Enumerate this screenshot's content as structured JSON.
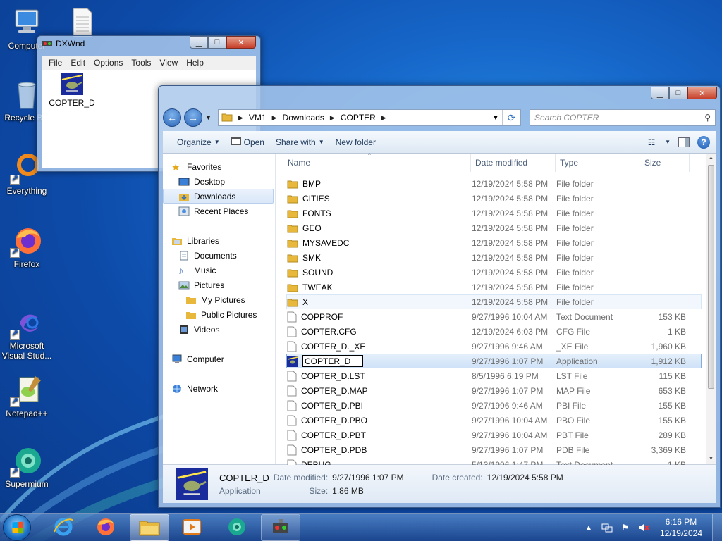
{
  "desktop": {
    "icons": [
      {
        "label": "Computer",
        "icon": "computer-icon"
      },
      {
        "label": "",
        "icon": "document-icon"
      },
      {
        "label": "Recycle Bin",
        "icon": "recycle-bin-icon"
      },
      {
        "label": "Everything",
        "icon": "everything-search-icon"
      },
      {
        "label": "Firefox",
        "icon": "firefox-icon"
      },
      {
        "label": "Microsoft Visual Stud...",
        "icon": "visual-studio-icon"
      },
      {
        "label": "Notepad++",
        "icon": "notepad-plus-plus-icon"
      },
      {
        "label": "Supermium",
        "icon": "supermium-icon"
      }
    ]
  },
  "dxwnd": {
    "title": "DXWnd",
    "menu": [
      "File",
      "Edit",
      "Options",
      "Tools",
      "View",
      "Help"
    ],
    "item_label": "COPTER_D"
  },
  "explorer": {
    "breadcrumb": [
      "VM1",
      "Downloads",
      "COPTER"
    ],
    "search_placeholder": "Search COPTER",
    "toolbar": {
      "organize": "Organize",
      "open": "Open",
      "share_with": "Share with",
      "new_folder": "New folder"
    },
    "nav": {
      "favorites": "Favorites",
      "desktop": "Desktop",
      "downloads": "Downloads",
      "recent_places": "Recent Places",
      "libraries": "Libraries",
      "documents": "Documents",
      "music": "Music",
      "pictures": "Pictures",
      "my_pictures": "My Pictures",
      "public_pictures": "Public Pictures",
      "videos": "Videos",
      "computer": "Computer",
      "network": "Network"
    },
    "columns": {
      "name": "Name",
      "date": "Date modified",
      "type": "Type",
      "size": "Size"
    },
    "files": [
      {
        "name": "BMP",
        "date": "12/19/2024 5:58 PM",
        "type": "File folder",
        "size": "",
        "kind": "folder"
      },
      {
        "name": "CITIES",
        "date": "12/19/2024 5:58 PM",
        "type": "File folder",
        "size": "",
        "kind": "folder"
      },
      {
        "name": "FONTS",
        "date": "12/19/2024 5:58 PM",
        "type": "File folder",
        "size": "",
        "kind": "folder"
      },
      {
        "name": "GEO",
        "date": "12/19/2024 5:58 PM",
        "type": "File folder",
        "size": "",
        "kind": "folder"
      },
      {
        "name": "MYSAVEDC",
        "date": "12/19/2024 5:58 PM",
        "type": "File folder",
        "size": "",
        "kind": "folder"
      },
      {
        "name": "SMK",
        "date": "12/19/2024 5:58 PM",
        "type": "File folder",
        "size": "",
        "kind": "folder"
      },
      {
        "name": "SOUND",
        "date": "12/19/2024 5:58 PM",
        "type": "File folder",
        "size": "",
        "kind": "folder"
      },
      {
        "name": "TWEAK",
        "date": "12/19/2024 5:58 PM",
        "type": "File folder",
        "size": "",
        "kind": "folder"
      },
      {
        "name": "X",
        "date": "12/19/2024 5:58 PM",
        "type": "File folder",
        "size": "",
        "kind": "folder",
        "state": "hover"
      },
      {
        "name": "COPPROF",
        "date": "9/27/1996 10:04 AM",
        "type": "Text Document",
        "size": "153 KB",
        "kind": "file"
      },
      {
        "name": "COPTER.CFG",
        "date": "12/19/2024 6:03 PM",
        "type": "CFG File",
        "size": "1 KB",
        "kind": "file"
      },
      {
        "name": "COPTER_D._XE",
        "date": "9/27/1996 9:46 AM",
        "type": "_XE File",
        "size": "1,960 KB",
        "kind": "file"
      },
      {
        "name": "COPTER_D",
        "date": "9/27/1996 1:07 PM",
        "type": "Application",
        "size": "1,912 KB",
        "kind": "app",
        "state": "selected"
      },
      {
        "name": "COPTER_D.LST",
        "date": "8/5/1996 6:19 PM",
        "type": "LST File",
        "size": "115 KB",
        "kind": "file"
      },
      {
        "name": "COPTER_D.MAP",
        "date": "9/27/1996 1:07 PM",
        "type": "MAP File",
        "size": "653 KB",
        "kind": "file"
      },
      {
        "name": "COPTER_D.PBI",
        "date": "9/27/1996 9:46 AM",
        "type": "PBI File",
        "size": "155 KB",
        "kind": "file"
      },
      {
        "name": "COPTER_D.PBO",
        "date": "9/27/1996 10:04 AM",
        "type": "PBO File",
        "size": "155 KB",
        "kind": "file"
      },
      {
        "name": "COPTER_D.PBT",
        "date": "9/27/1996 10:04 AM",
        "type": "PBT File",
        "size": "289 KB",
        "kind": "file"
      },
      {
        "name": "COPTER_D.PDB",
        "date": "9/27/1996 1:07 PM",
        "type": "PDB File",
        "size": "3,369 KB",
        "kind": "file"
      },
      {
        "name": "DEBUG",
        "date": "5/13/1996 1:47 PM",
        "type": "Text Document",
        "size": "1 KB",
        "kind": "file"
      }
    ],
    "details": {
      "name": "COPTER_D",
      "kind": "Application",
      "date_modified_label": "Date modified:",
      "date_modified": "9/27/1996 1:07 PM",
      "date_created_label": "Date created:",
      "date_created": "12/19/2024 5:58 PM",
      "size_label": "Size:",
      "size": "1.86 MB"
    }
  },
  "taskbar": {
    "apps": [
      {
        "name": "internet-explorer-icon",
        "state": "none"
      },
      {
        "name": "firefox-icon",
        "state": "none"
      },
      {
        "name": "file-explorer-icon",
        "state": "active"
      },
      {
        "name": "media-player-icon",
        "state": "none"
      },
      {
        "name": "supermium-icon",
        "state": "none"
      },
      {
        "name": "dxwnd-icon",
        "state": "open"
      }
    ],
    "time": "6:16 PM",
    "date": "12/19/2024"
  },
  "colors": {
    "wallpaper": "#1667c9",
    "selection": "#cfe2f8",
    "folder": "#e8b83d"
  }
}
